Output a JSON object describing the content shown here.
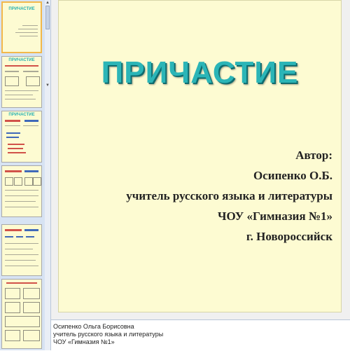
{
  "thumbnails": [
    {
      "title": "ПРИЧАСТИЕ"
    },
    {
      "title": "ПРИЧАСТИЕ"
    },
    {
      "title": "ПРИЧАСТИЕ"
    },
    {
      "title": ""
    },
    {
      "title": ""
    },
    {
      "title": ""
    }
  ],
  "slide": {
    "title": "ПРИЧАСТИЕ",
    "author_lines": [
      "Автор:",
      "Осипенко О.Б.",
      "учитель русского языка и литературы",
      "ЧОУ «Гимназия №1»",
      "г. Новороссийск"
    ]
  },
  "notes": {
    "lines": [
      "Осипенко Ольга Борисовна",
      "учитель русского языка и литературы",
      "ЧОУ «Гимназия №1»"
    ]
  },
  "colors": {
    "slide_bg": "#fdfbd2",
    "title": "#2bb5b7",
    "panel_bg": "#d7e3f3"
  }
}
